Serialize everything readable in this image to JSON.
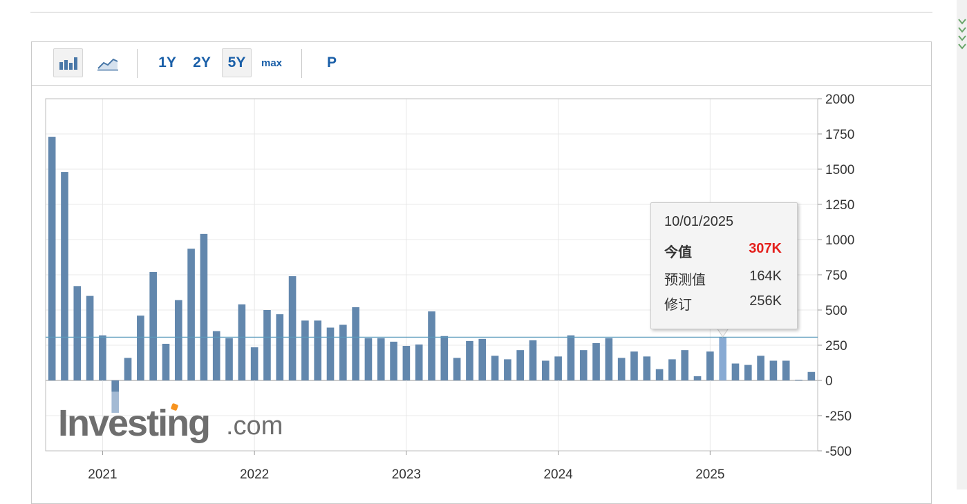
{
  "toolbar": {
    "range_buttons": [
      "1Y",
      "2Y",
      "5Y",
      "max"
    ],
    "active_range": "5Y",
    "period_button": "P",
    "chart_types": [
      "bar-chart-icon",
      "line-chart-icon"
    ],
    "active_chart_type": "bar-chart-icon"
  },
  "watermark": {
    "brand": "Investing",
    "suffix": ".com"
  },
  "tooltip": {
    "date": "10/01/2025",
    "actual_label": "今值",
    "actual_value": "307K",
    "forecast_label": "预测值",
    "forecast_value": "164K",
    "previous_label": "修订",
    "previous_value": "256K"
  },
  "colors": {
    "bar": "#6287ad",
    "bar_light": "#a3bad4",
    "bar_highlight": "#88aad3",
    "reference_line": "#5b9bbd",
    "tooltip_actual": "#e4211d",
    "link": "#1a5fa8"
  },
  "chart_data": {
    "type": "bar",
    "title": "",
    "xlabel": "",
    "ylabel": "",
    "ylim": [
      -500,
      2000
    ],
    "yticks": [
      2000,
      1750,
      1500,
      1250,
      1000,
      750,
      500,
      250,
      0,
      -250,
      -500
    ],
    "y_tick_labels": [
      "2000",
      "1750",
      "1500",
      "1250",
      "1000",
      "750",
      "500",
      "250",
      "0",
      "-250",
      "-500"
    ],
    "x_tick_labels": [
      "2021",
      "2022",
      "2023",
      "2024",
      "2025"
    ],
    "grid": true,
    "reference_line": {
      "value": 307
    },
    "highlighted_date": "10/01/2025",
    "series": [
      {
        "values": [
          1730,
          1480,
          670,
          600,
          320,
          -80,
          160,
          460,
          770,
          260,
          570,
          935,
          1040,
          350,
          300,
          540,
          235,
          500,
          470,
          740,
          425,
          425,
          375,
          395,
          520,
          300,
          300,
          275,
          245,
          255,
          490,
          315,
          160,
          280,
          295,
          175,
          150,
          215,
          285,
          140,
          170,
          320,
          215,
          265,
          300,
          160,
          205,
          170,
          80,
          150,
          215,
          30,
          205,
          307,
          120,
          110,
          175,
          140,
          140,
          5,
          60
        ],
        "secondary_values": [
          null,
          null,
          null,
          null,
          null,
          -230,
          null,
          null,
          null,
          null,
          null,
          null,
          null,
          null,
          null,
          null,
          null,
          null,
          null,
          null,
          null,
          null,
          null,
          null,
          null,
          null,
          null,
          null,
          null,
          null,
          null,
          null,
          null,
          null,
          null,
          null,
          null,
          null,
          null,
          null,
          null,
          null,
          null,
          null,
          null,
          null,
          null,
          null,
          null,
          null,
          null,
          null,
          null,
          307,
          null,
          null,
          null,
          null,
          null,
          null,
          null
        ]
      }
    ]
  }
}
